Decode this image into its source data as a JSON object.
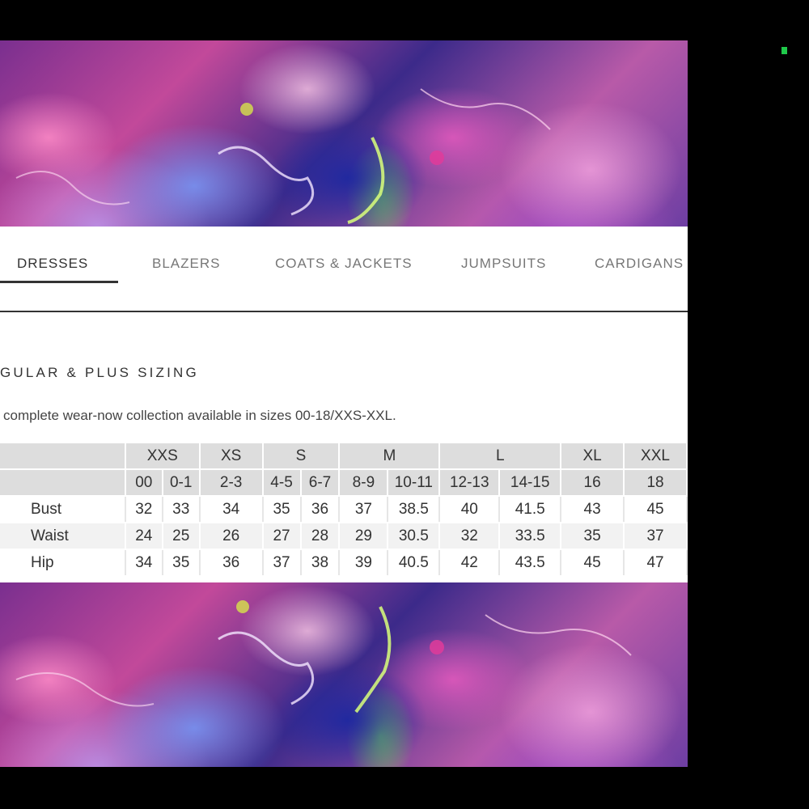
{
  "tabs": [
    {
      "label": "DRESSES",
      "active": true
    },
    {
      "label": "BLAZERS",
      "active": false
    },
    {
      "label": "COATS & JACKETS",
      "active": false
    },
    {
      "label": "JUMPSUITS",
      "active": false
    },
    {
      "label": "CARDIGANS",
      "active": false
    }
  ],
  "section": {
    "title": "GULAR & PLUS SIZING",
    "description": "complete wear-now collection available in sizes 00-18/XXS-XXL."
  },
  "size_table": {
    "groups": [
      "XXS",
      "XS",
      "S",
      "M",
      "L",
      "XL",
      "XXL"
    ],
    "sizes": [
      "00",
      "0-1",
      "2-3",
      "4-5",
      "6-7",
      "8-9",
      "10-11",
      "12-13",
      "14-15",
      "16",
      "18"
    ],
    "rows": [
      {
        "label": "Bust",
        "values": [
          "32",
          "33",
          "34",
          "35",
          "36",
          "37",
          "38.5",
          "40",
          "41.5",
          "43",
          "45"
        ]
      },
      {
        "label": "Waist",
        "values": [
          "24",
          "25",
          "26",
          "27",
          "28",
          "29",
          "30.5",
          "32",
          "33.5",
          "35",
          "37"
        ]
      },
      {
        "label": "Hip",
        "values": [
          "34",
          "35",
          "36",
          "37",
          "38",
          "39",
          "40.5",
          "42",
          "43.5",
          "45",
          "47"
        ]
      }
    ]
  },
  "colors": {
    "background": "#000000",
    "panel": "#ffffff",
    "header_row": "#dddddd",
    "band_row": "#f2f2f2",
    "text": "#333333",
    "corner_mark": "#1fc94a"
  }
}
